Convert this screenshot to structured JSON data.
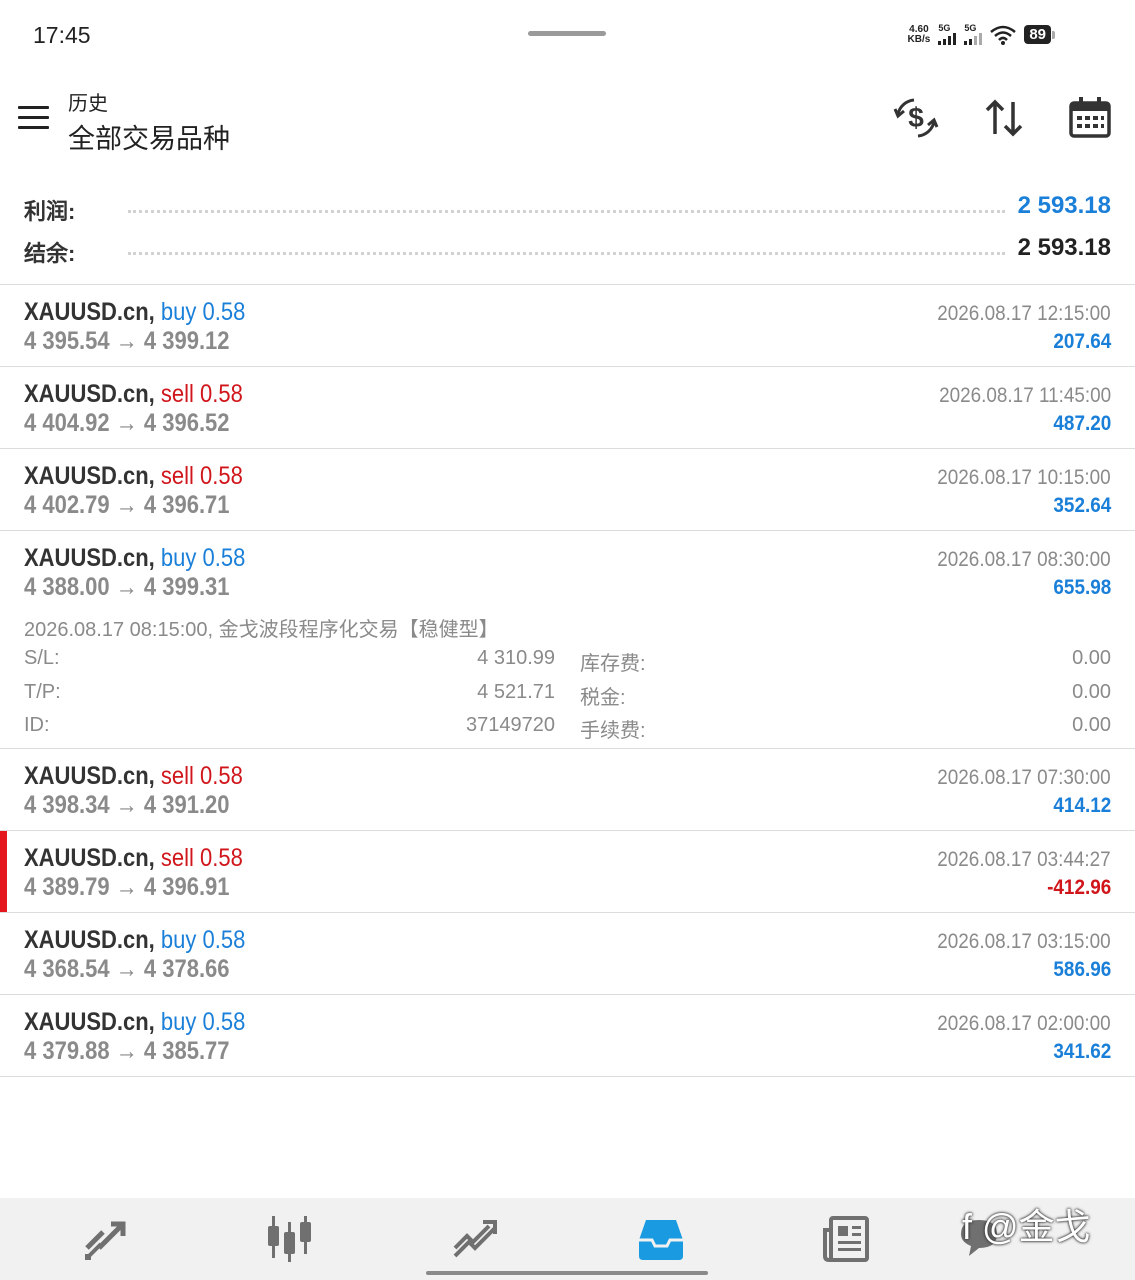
{
  "status_bar": {
    "time": "17:45",
    "net_speed_value": "4.60",
    "net_speed_unit": "KB/s",
    "signal1_label": "5G",
    "signal2_label": "5G",
    "battery": "89"
  },
  "header": {
    "subtitle": "历史",
    "title": "全部交易品种",
    "icons": [
      "menu-icon",
      "currency-exchange-icon",
      "sort-icon",
      "calendar-icon"
    ]
  },
  "summary": {
    "profit_label": "利润:",
    "profit_value": "2 593.18",
    "balance_label": "结余:",
    "balance_value": "2 593.18"
  },
  "colors": {
    "buy": "#1a7fd8",
    "sell": "#d0161b",
    "positive": "#1a7fd8",
    "negative": "#d0161b",
    "loss_marker": "#e5161d",
    "active_tab": "#1a9ae0"
  },
  "trades": [
    {
      "symbol": "XAUUSD.cn,",
      "side": "buy",
      "volume": "0.58",
      "open": "4 395.54",
      "arrow": "→",
      "close": "4 399.12",
      "time": "2026.08.17 12:15:00",
      "profit": "207.64"
    },
    {
      "symbol": "XAUUSD.cn,",
      "side": "sell",
      "volume": "0.58",
      "open": "4 404.92",
      "arrow": "→",
      "close": "4 396.52",
      "time": "2026.08.17 11:45:00",
      "profit": "487.20"
    },
    {
      "symbol": "XAUUSD.cn,",
      "side": "sell",
      "volume": "0.58",
      "open": "4 402.79",
      "arrow": "→",
      "close": "4 396.71",
      "time": "2026.08.17 10:15:00",
      "profit": "352.64"
    },
    {
      "symbol": "XAUUSD.cn,",
      "side": "buy",
      "volume": "0.58",
      "open": "4 388.00",
      "arrow": "→",
      "close": "4 399.31",
      "time": "2026.08.17 08:30:00",
      "profit": "655.98",
      "details": {
        "comment": "2026.08.17 08:15:00, 金戈波段程序化交易【稳健型】",
        "sl_label": "S/L:",
        "sl_value": "4 310.99",
        "tp_label": "T/P:",
        "tp_value": "4 521.71",
        "id_label": "ID:",
        "id_value": "37149720",
        "swap_label": "库存费:",
        "swap_value": "0.00",
        "tax_label": "税金:",
        "tax_value": "0.00",
        "fee_label": "手续费:",
        "fee_value": "0.00"
      }
    },
    {
      "symbol": "XAUUSD.cn,",
      "side": "sell",
      "volume": "0.58",
      "open": "4 398.34",
      "arrow": "→",
      "close": "4 391.20",
      "time": "2026.08.17 07:30:00",
      "profit": "414.12"
    },
    {
      "symbol": "XAUUSD.cn,",
      "side": "sell",
      "volume": "0.58",
      "open": "4 389.79",
      "arrow": "→",
      "close": "4 396.91",
      "time": "2026.08.17 03:44:27",
      "profit": "-412.96"
    },
    {
      "symbol": "XAUUSD.cn,",
      "side": "buy",
      "volume": "0.58",
      "open": "4 368.54",
      "arrow": "→",
      "close": "4 378.66",
      "time": "2026.08.17 03:15:00",
      "profit": "586.96"
    },
    {
      "symbol": "XAUUSD.cn,",
      "side": "buy",
      "volume": "0.58",
      "open": "4 379.88",
      "arrow": "→",
      "close": "4 385.77",
      "time": "2026.08.17 02:00:00",
      "profit": "341.62"
    }
  ],
  "bottom_nav": {
    "items": [
      "quotes-icon",
      "chart-icon",
      "trade-icon",
      "history-icon",
      "news-icon",
      "messages-icon"
    ],
    "active": "history-icon"
  },
  "watermark": "f @金戈"
}
